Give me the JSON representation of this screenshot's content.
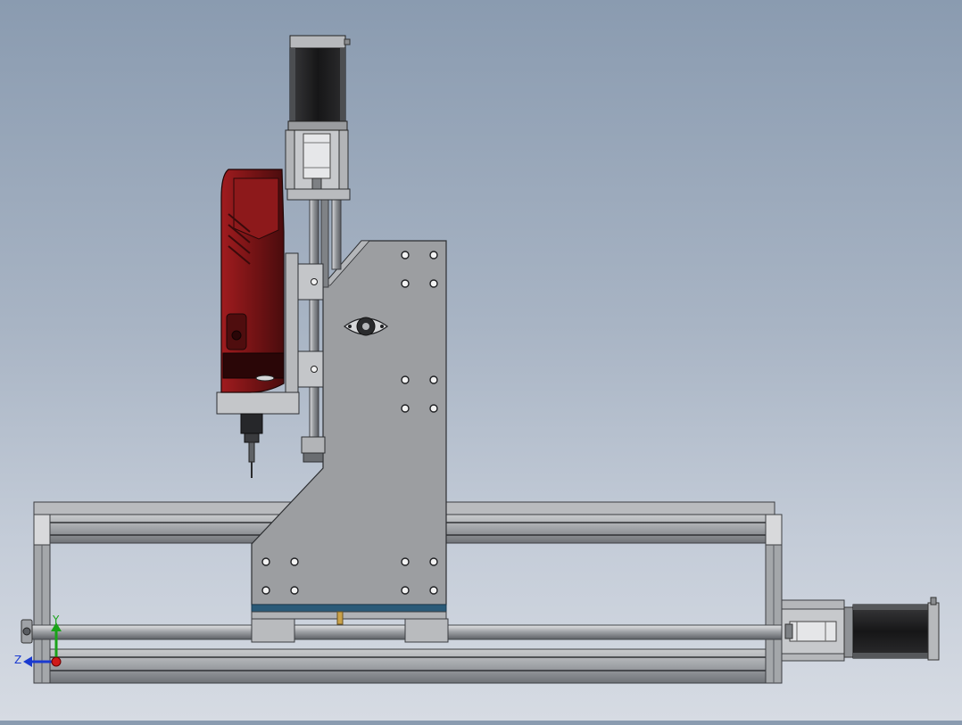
{
  "scene": {
    "colors": {
      "background_top": "#8a9bb0",
      "background_bottom": "#d6dbe3",
      "aluminium": "#a9acaf",
      "aluminium_dark": "#6f7277",
      "plate": "#9a9c9f",
      "motor": "#1b1b1c",
      "spindle_red": "#7a1416",
      "accent_blue": "#2a5a78"
    },
    "components": [
      {
        "name": "z-axis-stepper-motor",
        "icon": "stepper-motor-icon"
      },
      {
        "name": "x-axis-stepper-motor",
        "icon": "stepper-motor-icon"
      },
      {
        "name": "spindle-router",
        "icon": "spindle-icon"
      },
      {
        "name": "gantry-plate",
        "icon": "plate-icon"
      },
      {
        "name": "aluminium-frame",
        "icon": "frame-icon"
      },
      {
        "name": "linear-rod",
        "icon": "rod-icon"
      }
    ]
  },
  "triad": {
    "y_label": "Y",
    "z_label": "Z",
    "y_color": "#1aa31a",
    "z_color": "#1a3ad0",
    "origin_color": "#d01a1a"
  }
}
